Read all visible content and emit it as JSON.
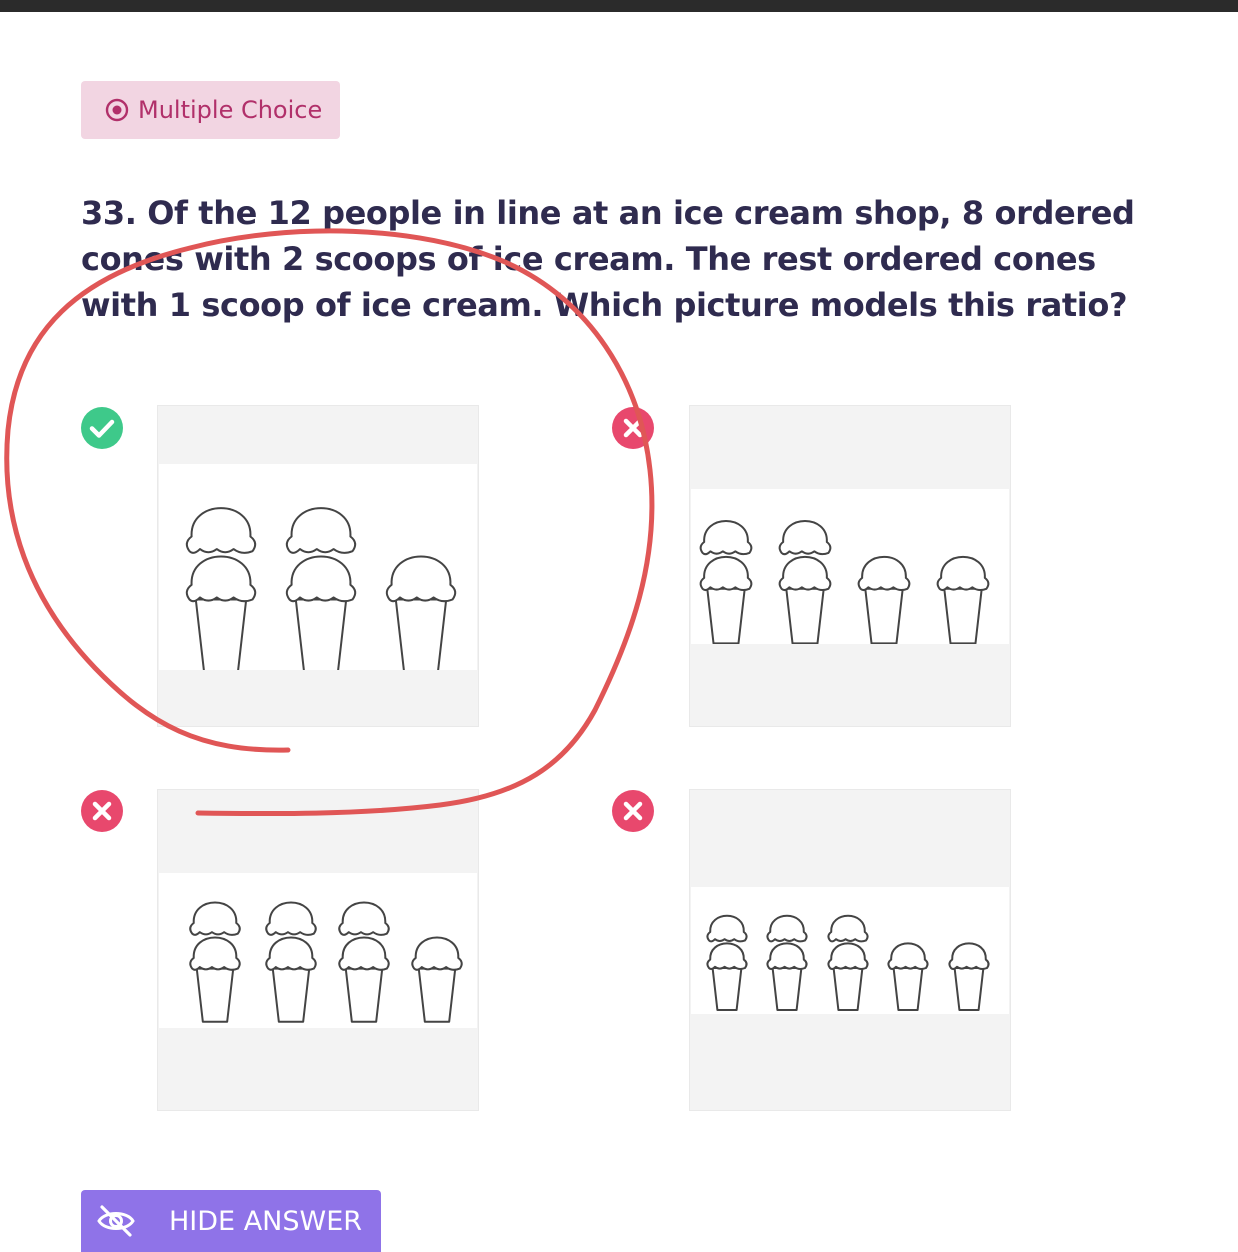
{
  "colors": {
    "badge_bg": "#f2d5e2",
    "badge_text": "#b1306a",
    "question_text": "#2f2b4f",
    "correct": "#3ec98a",
    "incorrect": "#e8486d",
    "button_bg": "#8f73e8",
    "annotation_stroke": "#e05656"
  },
  "badge": {
    "icon": "radio-dot-icon",
    "label": "Multiple Choice"
  },
  "question": {
    "text": "33. Of the 12 people in line at an ice cream shop, 8 ordered cones with 2 scoops of ice cream. The rest ordered cones with 1 scoop of ice cream. Which picture models this ratio?"
  },
  "options": [
    {
      "status": "correct",
      "icon": "check-circle-icon",
      "double_scoop_cones": 2,
      "single_scoop_cones": 1
    },
    {
      "status": "incorrect",
      "icon": "x-circle-icon",
      "double_scoop_cones": 2,
      "single_scoop_cones": 2
    },
    {
      "status": "incorrect",
      "icon": "x-circle-icon",
      "double_scoop_cones": 3,
      "single_scoop_cones": 1
    },
    {
      "status": "incorrect",
      "icon": "x-circle-icon",
      "double_scoop_cones": 3,
      "single_scoop_cones": 2
    }
  ],
  "actions": {
    "hide_answer_label": "HIDE ANSWER",
    "hide_answer_icon": "eye-off-icon"
  }
}
